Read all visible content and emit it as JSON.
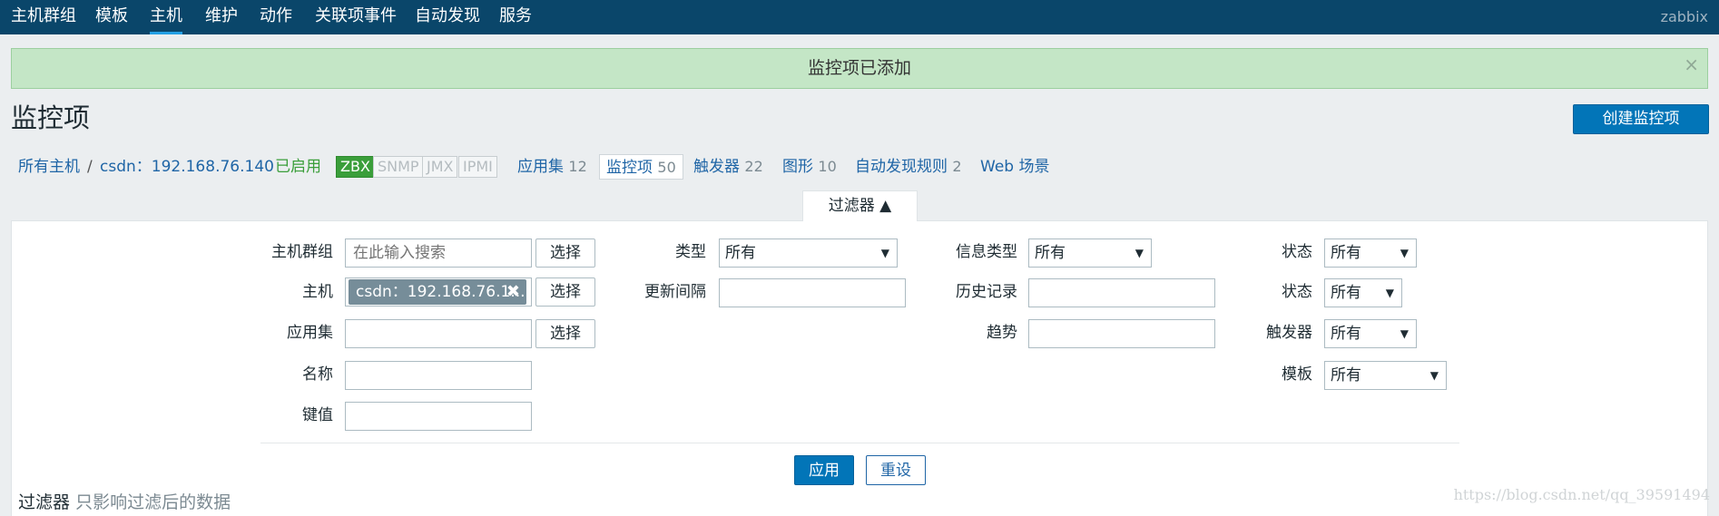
{
  "topnav": {
    "items": [
      "主机群组",
      "模板",
      "主机",
      "维护",
      "动作",
      "关联项事件",
      "自动发现",
      "服务"
    ],
    "active": "主机",
    "brand": "zabbix",
    "bg_color": "#0a466a"
  },
  "message": {
    "text": "监控项已添加",
    "close": "×",
    "color": "#c4e6c6"
  },
  "header": {
    "title": "监控项",
    "create_button": "创建监控项"
  },
  "breadcrumb": {
    "all_hosts": "所有主机",
    "separator": "/",
    "host": "csdn：192.168.76.140",
    "status": "已启用",
    "availability": [
      "ZBX",
      "SNMP",
      "JMX",
      "IPMI"
    ],
    "applications": {
      "label": "应用集",
      "count": "12"
    },
    "items": {
      "label": "监控项",
      "count": "50"
    },
    "triggers": {
      "label": "触发器",
      "count": "22"
    },
    "graphs": {
      "label": "图形",
      "count": "10"
    },
    "discovery": {
      "label": "自动发现规则",
      "count": "2"
    },
    "web": {
      "label": "Web 场景"
    }
  },
  "filter": {
    "tab_label": "过滤器 ▲",
    "host_group": {
      "label": "主机群组",
      "placeholder": "在此输入搜索",
      "button": "选择"
    },
    "host": {
      "label": "主机",
      "chip": "csdn：192.168.76.1...",
      "button": "选择"
    },
    "application": {
      "label": "应用集",
      "value": "",
      "button": "选择"
    },
    "name": {
      "label": "名称",
      "value": ""
    },
    "key": {
      "label": "键值",
      "value": ""
    },
    "type": {
      "label": "类型",
      "value": "所有"
    },
    "update_interval": {
      "label": "更新间隔",
      "value": ""
    },
    "info_type": {
      "label": "信息类型",
      "value": "所有"
    },
    "history": {
      "label": "历史记录",
      "value": ""
    },
    "trends": {
      "label": "趋势",
      "value": ""
    },
    "state": {
      "label": "状态",
      "value": "所有"
    },
    "status": {
      "label": "状态",
      "value": "所有"
    },
    "triggers": {
      "label": "触发器",
      "value": "所有"
    },
    "template": {
      "label": "模板",
      "value": "所有"
    },
    "apply_button": "应用",
    "reset_button": "重设"
  },
  "footer": {
    "filter_label": "过滤器",
    "filter_hint": "只影响过滤后的数据"
  },
  "watermark": "https://blog.csdn.net/qq_39591494"
}
